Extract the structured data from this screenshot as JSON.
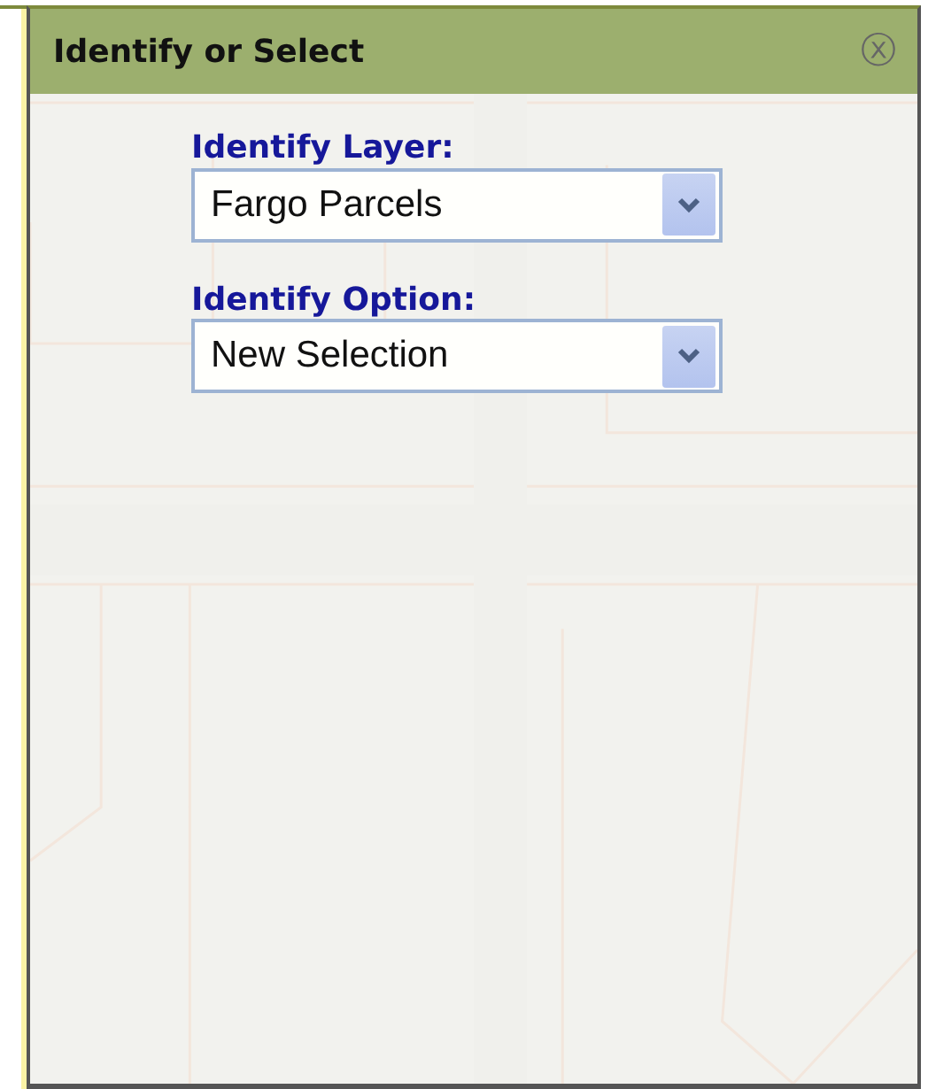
{
  "panel": {
    "title": "Identify or Select",
    "close_icon": "ⓧ"
  },
  "fields": [
    {
      "label": "Identify Layer:",
      "value": "Fargo Parcels"
    },
    {
      "label": "Identify Option:",
      "value": "New Selection"
    }
  ]
}
